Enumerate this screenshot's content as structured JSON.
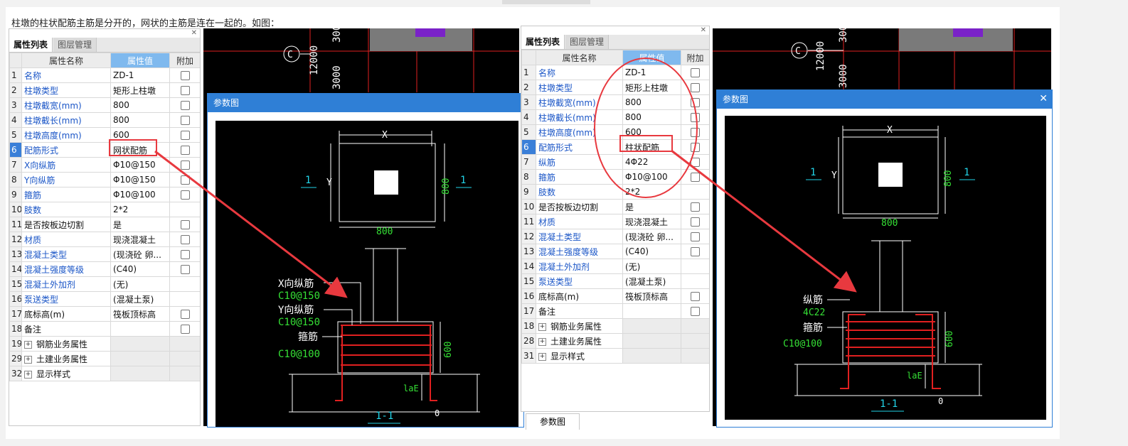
{
  "intro_text": "柱墩的柱状配筋主筋是分开的，网状的主筋是连在一起的。如图：",
  "panel_tabs": {
    "active": "属性列表",
    "inactive": "图层管理"
  },
  "columns": {
    "name": "属性名称",
    "value": "属性值",
    "extra": "附加"
  },
  "left_rows": [
    {
      "n": "1",
      "name": "名称",
      "value": "ZD-1",
      "blue": true,
      "cb": true
    },
    {
      "n": "2",
      "name": "柱墩类型",
      "value": "矩形上柱墩",
      "blue": true,
      "cb": true
    },
    {
      "n": "3",
      "name": "柱墩截宽(mm)",
      "value": "800",
      "blue": true,
      "cb": true
    },
    {
      "n": "4",
      "name": "柱墩截长(mm)",
      "value": "800",
      "blue": true,
      "cb": true
    },
    {
      "n": "5",
      "name": "柱墩高度(mm)",
      "value": "600",
      "blue": true,
      "cb": true
    },
    {
      "n": "6",
      "name": "配筋形式",
      "value": "网状配筋",
      "blue": true,
      "cb": true,
      "sel": true
    },
    {
      "n": "7",
      "name": "X向纵筋",
      "value": "Φ10@150",
      "blue": true,
      "cb": true
    },
    {
      "n": "8",
      "name": "Y向纵筋",
      "value": "Φ10@150",
      "blue": true,
      "cb": true
    },
    {
      "n": "9",
      "name": "箍筋",
      "value": "Φ10@100",
      "blue": true,
      "cb": true
    },
    {
      "n": "10",
      "name": "肢数",
      "value": "2*2",
      "blue": true,
      "cb": false
    },
    {
      "n": "11",
      "name": "是否按板边切割",
      "value": "是",
      "blue": false,
      "cb": true
    },
    {
      "n": "12",
      "name": "材质",
      "value": "现浇混凝土",
      "blue": true,
      "cb": true
    },
    {
      "n": "13",
      "name": "混凝土类型",
      "value": "(现浇砼 卵...",
      "blue": true,
      "cb": true
    },
    {
      "n": "14",
      "name": "混凝土强度等级",
      "value": "(C40)",
      "blue": true,
      "cb": true
    },
    {
      "n": "15",
      "name": "混凝土外加剂",
      "value": "(无)",
      "blue": true,
      "cb": false
    },
    {
      "n": "16",
      "name": "泵送类型",
      "value": "(混凝土泵)",
      "blue": true,
      "cb": false
    },
    {
      "n": "17",
      "name": "底标高(m)",
      "value": "筏板顶标高",
      "blue": false,
      "cb": true
    },
    {
      "n": "18",
      "name": "备注",
      "value": "",
      "blue": false,
      "cb": true
    },
    {
      "n": "19",
      "name": "钢筋业务属性",
      "value": "",
      "blue": false,
      "cb": false,
      "group": true
    },
    {
      "n": "29",
      "name": "土建业务属性",
      "value": "",
      "blue": false,
      "cb": false,
      "group": true
    },
    {
      "n": "32",
      "name": "显示样式",
      "value": "",
      "blue": false,
      "cb": false,
      "group": true
    }
  ],
  "right_rows": [
    {
      "n": "1",
      "name": "名称",
      "value": "ZD-1",
      "blue": true,
      "cb": true
    },
    {
      "n": "2",
      "name": "柱墩类型",
      "value": "矩形上柱墩",
      "blue": true,
      "cb": true
    },
    {
      "n": "3",
      "name": "柱墩截宽(mm)",
      "value": "800",
      "blue": true,
      "cb": true
    },
    {
      "n": "4",
      "name": "柱墩截长(mm)",
      "value": "800",
      "blue": true,
      "cb": true
    },
    {
      "n": "5",
      "name": "柱墩高度(mm)",
      "value": "600",
      "blue": true,
      "cb": true
    },
    {
      "n": "6",
      "name": "配筋形式",
      "value": "柱状配筋",
      "blue": true,
      "cb": true,
      "sel": true
    },
    {
      "n": "7",
      "name": "纵筋",
      "value": "4Φ22",
      "blue": true,
      "cb": true
    },
    {
      "n": "8",
      "name": "箍筋",
      "value": "Φ10@100",
      "blue": true,
      "cb": true
    },
    {
      "n": "9",
      "name": "肢数",
      "value": "2*2",
      "blue": true,
      "cb": false
    },
    {
      "n": "10",
      "name": "是否按板边切割",
      "value": "是",
      "blue": false,
      "cb": true
    },
    {
      "n": "11",
      "name": "材质",
      "value": "现浇混凝土",
      "blue": true,
      "cb": true
    },
    {
      "n": "12",
      "name": "混凝土类型",
      "value": "(现浇砼 卵...",
      "blue": true,
      "cb": true
    },
    {
      "n": "13",
      "name": "混凝土强度等级",
      "value": "(C40)",
      "blue": true,
      "cb": true
    },
    {
      "n": "14",
      "name": "混凝土外加剂",
      "value": "(无)",
      "blue": true,
      "cb": false
    },
    {
      "n": "15",
      "name": "泵送类型",
      "value": "(混凝土泵)",
      "blue": true,
      "cb": false
    },
    {
      "n": "16",
      "name": "底标高(m)",
      "value": "筏板顶标高",
      "blue": false,
      "cb": true
    },
    {
      "n": "17",
      "name": "备注",
      "value": "",
      "blue": false,
      "cb": true
    },
    {
      "n": "18",
      "name": "钢筋业务属性",
      "value": "",
      "blue": false,
      "cb": false,
      "group": true
    },
    {
      "n": "28",
      "name": "土建业务属性",
      "value": "",
      "blue": false,
      "cb": false,
      "group": true
    },
    {
      "n": "31",
      "name": "显示样式",
      "value": "",
      "blue": false,
      "cb": false,
      "group": true
    }
  ],
  "dialog_title": "参数图",
  "bottom_tab": "参数图",
  "grid_labels": {
    "axis": "C",
    "dim1": "12000",
    "dim2": "3000",
    "dim3": "300"
  },
  "left_drawing": {
    "dim_x": "X",
    "dim_y": "Y",
    "w": "800",
    "h": "800",
    "sec": "1",
    "xbar_label": "X向纵筋",
    "xbar_spec": "C10@150",
    "ybar_label": "Y向纵筋",
    "ybar_spec": "C10@150",
    "stir_label": "箍筋",
    "stir_spec": "C10@100",
    "height": "600",
    "lae": "laE",
    "section": "1-1",
    "zero": "0"
  },
  "right_drawing": {
    "dim_x": "X",
    "dim_y": "Y",
    "w": "800",
    "h": "800",
    "sec": "1",
    "bar_label": "纵筋",
    "bar_spec": "4C22",
    "stir_label": "箍筋",
    "stir_spec": "C10@100",
    "height": "600",
    "lae": "laE",
    "section": "1-1",
    "zero": "0"
  },
  "colors": {
    "cad_red": "#e02020",
    "cad_green": "#35e035",
    "cad_cyan": "#22d4e8",
    "annot_red": "#e8393f",
    "purple": "#7a22c8"
  }
}
